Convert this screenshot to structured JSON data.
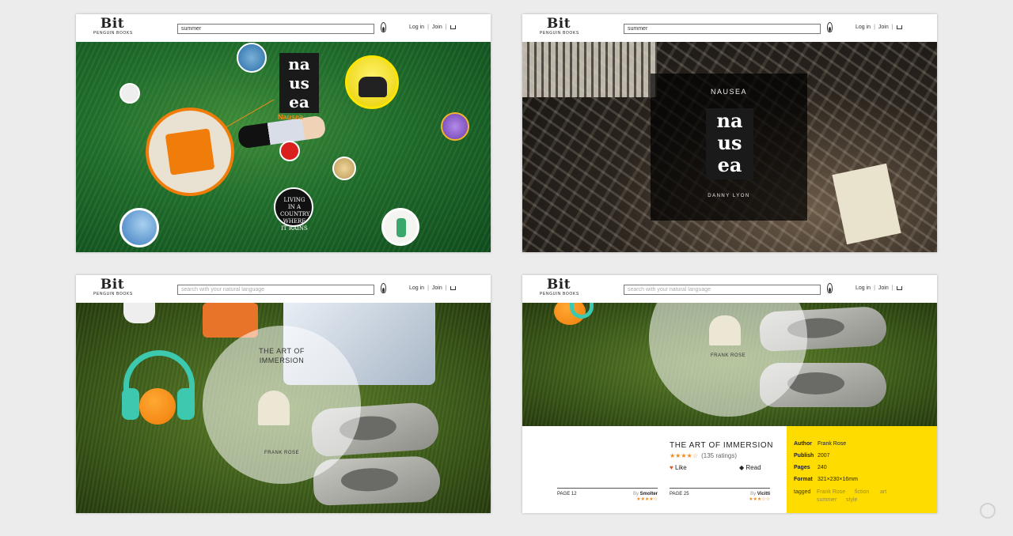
{
  "header": {
    "logo_mark": "Bit",
    "logo_sub": "PENGUIN BOOKS",
    "login": "Log in",
    "join": "Join",
    "separator": "|"
  },
  "panel1": {
    "search_value": "summer",
    "book_title": "Nausea",
    "cover_letters": "na\nus\nea",
    "small_cover_text": "LIVING IN A COUNTRY WHERE IT RAINS"
  },
  "panel2": {
    "search_value": "summer",
    "title": "NAUSEA",
    "author": "DANNY LYON",
    "cover_letters": "na\nus\nea"
  },
  "panel3": {
    "search_placeholder": "search with your natural language",
    "title_line1": "THE ART OF",
    "title_line2": "IMMERSION",
    "author": "FRANK ROSE"
  },
  "panel4": {
    "search_placeholder": "search with your natural language",
    "circle_author": "FRANK ROSE",
    "title": "THE ART OF IMMERSION",
    "stars": "★★★★☆",
    "ratings": "(135 ratings)",
    "like": "Like",
    "read": "Read",
    "review1": {
      "page": "PAGE 12",
      "by": "By",
      "name": "Smolter",
      "stars": "★★★★☆"
    },
    "review2": {
      "page": "PAGE 25",
      "by": "By",
      "name": "Vicitti",
      "stars": "★★★☆☆"
    },
    "meta": {
      "author_label": "Author",
      "author": "Frank Rose",
      "publish_label": "Publish",
      "publish": "2007",
      "pages_label": "Pages",
      "pages": "240",
      "format_label": "Format",
      "format": "321×230×16mm"
    },
    "tagged_label": "tagged",
    "tags": [
      "Frank Rose",
      "fiction",
      "art",
      "summer",
      "style"
    ]
  },
  "colors": {
    "accent_orange": "#f07d0a",
    "yellow": "#ffdc00",
    "teal": "#3cc9b0"
  }
}
